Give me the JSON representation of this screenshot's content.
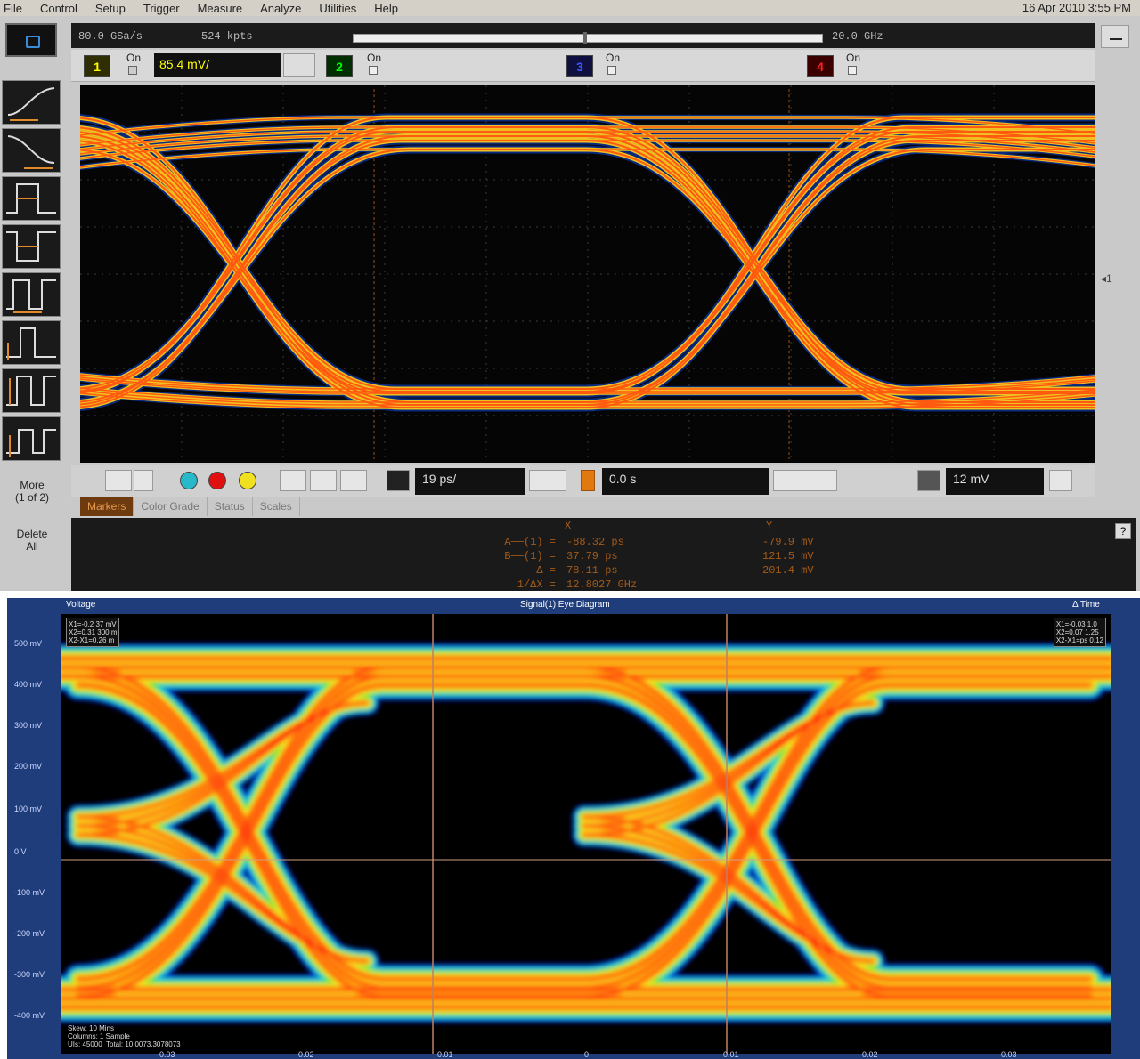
{
  "menu": [
    "File",
    "Control",
    "Setup",
    "Trigger",
    "Measure",
    "Analyze",
    "Utilities",
    "Help"
  ],
  "clock": "16 Apr 2010  3:55 PM",
  "acquisition": {
    "sample_rate": "80.0 GSa/s",
    "memory_depth": "524 kpts",
    "bandwidth": "20.0 GHz"
  },
  "channels": {
    "ch1": {
      "number": "1",
      "on_label": "On",
      "scale": "85.4 mV/",
      "color": "#ffff00"
    },
    "ch2": {
      "number": "2",
      "on_label": "On",
      "color": "#00ff00"
    },
    "ch3": {
      "number": "3",
      "on_label": "On",
      "color": "#3a5bff"
    },
    "ch4": {
      "number": "4",
      "on_label": "On",
      "color": "#ff2020"
    }
  },
  "controls": {
    "time_scale": "19 ps/",
    "time_offset": "0.0 s",
    "trigger_level": "12 mV"
  },
  "sidebar": {
    "more_label": "More\n(1 of 2)",
    "delete_label": "Delete\nAll"
  },
  "tabs": [
    {
      "label": "Markers",
      "active": true
    },
    {
      "label": "Color Grade",
      "active": false
    },
    {
      "label": "Status",
      "active": false
    },
    {
      "label": "Scales",
      "active": false
    }
  ],
  "markers": {
    "header_x": "X",
    "header_y": "Y",
    "rows": [
      {
        "label": "A──(1) =",
        "x": "-88.32 ps",
        "y": "-79.9 mV"
      },
      {
        "label": "B──(1) =",
        "x": "37.79 ps",
        "y": "121.5 mV"
      },
      {
        "label": "Δ =",
        "x": "78.11 ps",
        "y": "201.4 mV"
      },
      {
        "label": "1/ΔX =",
        "x": "12.8027 GHz",
        "y": ""
      }
    ]
  },
  "eye2": {
    "header_left": "Voltage",
    "header_center": "Signal(1) Eye Diagram",
    "header_right": "Δ Time",
    "y_ticks": [
      "500 mV",
      "400 mV",
      "300 mV",
      "200 mV",
      "100 mV",
      "0 V",
      "-100 mV",
      "-200 mV",
      "-300 mV",
      "-400 mV"
    ],
    "x_ticks": [
      "-0.03",
      "-0.02",
      "-0.01",
      "0",
      "0.01",
      "0.02",
      "0.03"
    ],
    "legend_tl": "X1=-0.2 37 mV\nX2=0.31 300 m\nX2-X1=0.26 m",
    "legend_tr": "X1=-0.03 1.0\nX2=0.07 1.25\nX2-X1=ps 0.12",
    "legend_bl": "Skew: 10 Mins\nColumns: 1 Sample\nUIs: 45000  Total: 10 0073.3078073"
  },
  "icons": [
    "tektronix-logo-icon",
    "rise-time-icon",
    "fall-time-icon",
    "pulse-width-icon",
    "period-icon"
  ]
}
